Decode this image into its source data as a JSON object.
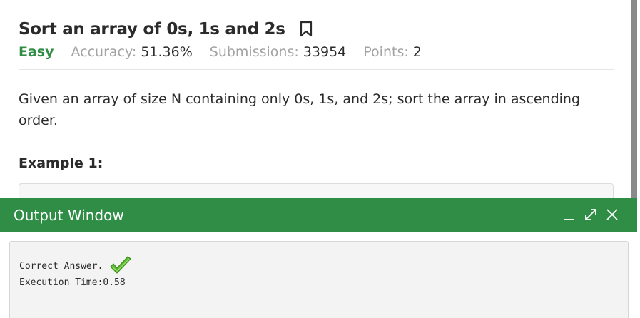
{
  "problem": {
    "title": "Sort an array of 0s, 1s and 2s",
    "difficulty": "Easy",
    "accuracy_label": "Accuracy: ",
    "accuracy_value": "51.36%",
    "submissions_label": "Submissions: ",
    "submissions_value": "33954",
    "points_label": "Points: ",
    "points_value": "2",
    "description": "Given an array of size N containing only 0s, 1s, and 2s; sort the array in ascending order.",
    "example_heading": "Example 1:"
  },
  "output_window": {
    "title": "Output Window",
    "result_text": "Correct Answer.",
    "execution_time": "Execution Time:0.58"
  },
  "colors": {
    "brand_green": "#2f8d46",
    "muted_label": "#a3a3a3",
    "text": "#2b2b2b"
  },
  "icons": {
    "bookmark": "bookmark-icon",
    "minimize": "minimize-icon",
    "expand": "expand-icon",
    "close": "close-icon",
    "check": "checkmark-icon"
  }
}
